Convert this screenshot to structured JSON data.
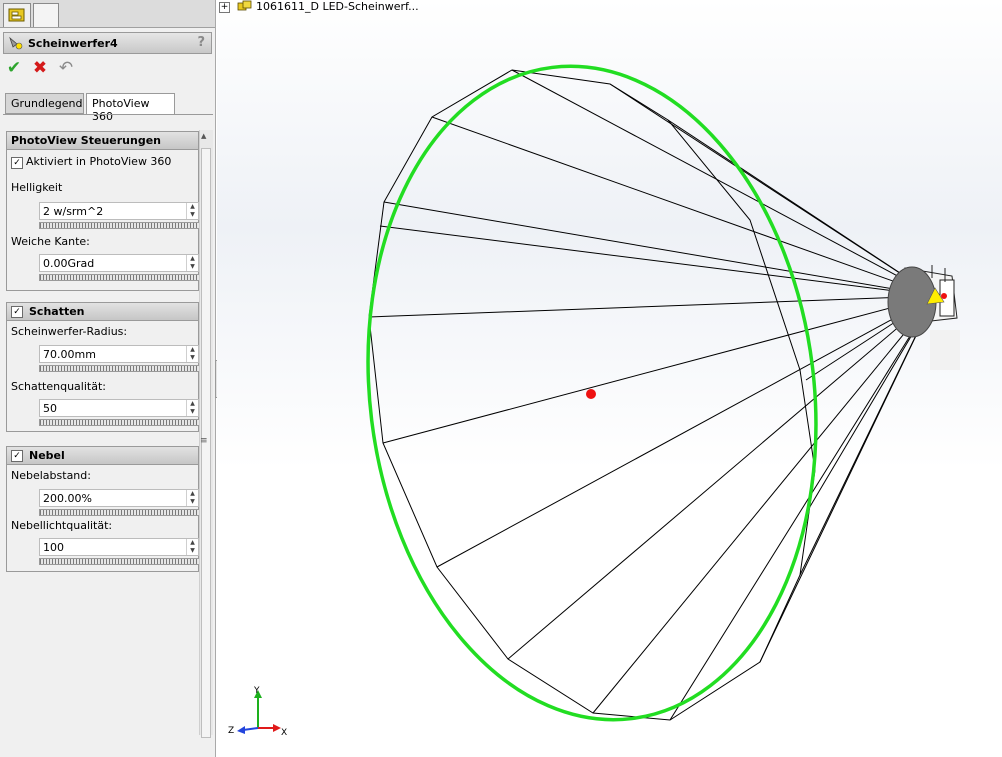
{
  "feature": {
    "title": "Scheinwerfer4",
    "help": "?"
  },
  "actions": {
    "ok": "✔",
    "cancel": "✖",
    "undo": "↶"
  },
  "tabs": {
    "grundlegend": "Grundlegend",
    "photoview": "PhotoView 360"
  },
  "photoview_group": {
    "title": "PhotoView Steuerungen",
    "enabled_label": "Aktiviert in PhotoView 360",
    "brightness_label": "Helligkeit",
    "brightness_value": "2 w/srm^2",
    "soft_edge_label": "Weiche Kante:",
    "soft_edge_value": "0.00Grad"
  },
  "shadow_group": {
    "title": "Schatten",
    "radius_label": "Scheinwerfer-Radius:",
    "radius_value": "70.00mm",
    "quality_label": "Schattenqualität:",
    "quality_value": "50"
  },
  "fog_group": {
    "title": "Nebel",
    "distance_label": "Nebelabstand:",
    "distance_value": "200.00%",
    "quality_label": "Nebellichtqualität:",
    "quality_value": "100"
  },
  "tree": {
    "expand": "+",
    "item": "1061611_D LED-Scheinwerf..."
  },
  "triad": {
    "x": "X",
    "y": "Y",
    "z": "Z"
  },
  "colors": {
    "cone_ring": "#22dd22",
    "target_point": "#ee1111",
    "light_yellow": "#ffee00"
  }
}
